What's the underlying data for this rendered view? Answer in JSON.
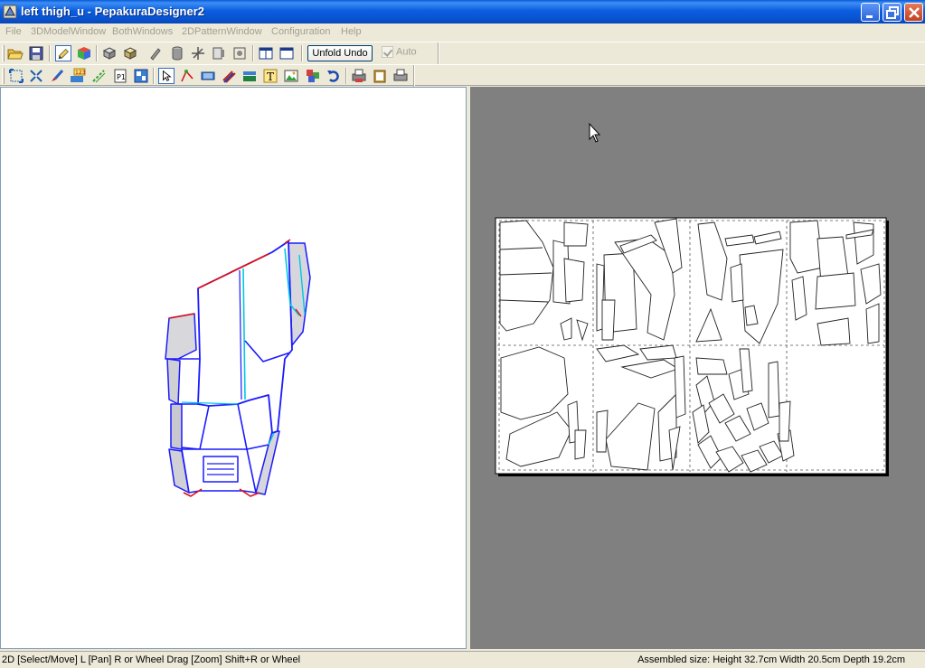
{
  "window": {
    "title": "left thigh_u - PepakuraDesigner2"
  },
  "menu": {
    "items": [
      "File",
      "3DModelWindow",
      "BothWindows",
      "2DPatternWindow",
      "Configuration",
      "Help"
    ]
  },
  "toolbar": {
    "unfold_undo_label": "Unfold Undo",
    "auto_label": "Auto",
    "auto_checked": true
  },
  "status": {
    "hint": "2D [Select/Move] L [Pan] R or Wheel Drag [Zoom] Shift+R or Wheel",
    "assembled_size": "Assembled size: Height 32.7cm Width 20.5cm Depth 19.2cm"
  },
  "colors": {
    "titlebar": "#0b5ee0",
    "pane_2d_bg": "#808080",
    "pane_3d_bg": "#ffffff",
    "model_edge_blue": "#1a1aff",
    "model_edge_cyan": "#00c8e6",
    "model_edge_red": "#e01010"
  },
  "icons": {
    "toolbar1": [
      "open-icon",
      "save-icon",
      "select-3d-icon",
      "color-cube-icon",
      "cube-flat-icon",
      "cube-shade-icon",
      "pencil-icon",
      "cylinder-icon",
      "axis-icon",
      "texture-icon",
      "target-icon",
      "window-single-icon",
      "window-split-icon"
    ],
    "toolbar2": [
      "fit-icon",
      "zoom-area-icon",
      "brush-icon",
      "number-icon",
      "edge-line-icon",
      "page-icon",
      "layout-icon",
      "select-arrow-icon",
      "join-edge-icon",
      "flap-icon",
      "diag-lines-icon",
      "rotate-icon",
      "text-icon",
      "image-icon",
      "parts-icon",
      "undo-icon",
      "printer-a-icon",
      "clipboard-icon",
      "printer-icon"
    ]
  }
}
